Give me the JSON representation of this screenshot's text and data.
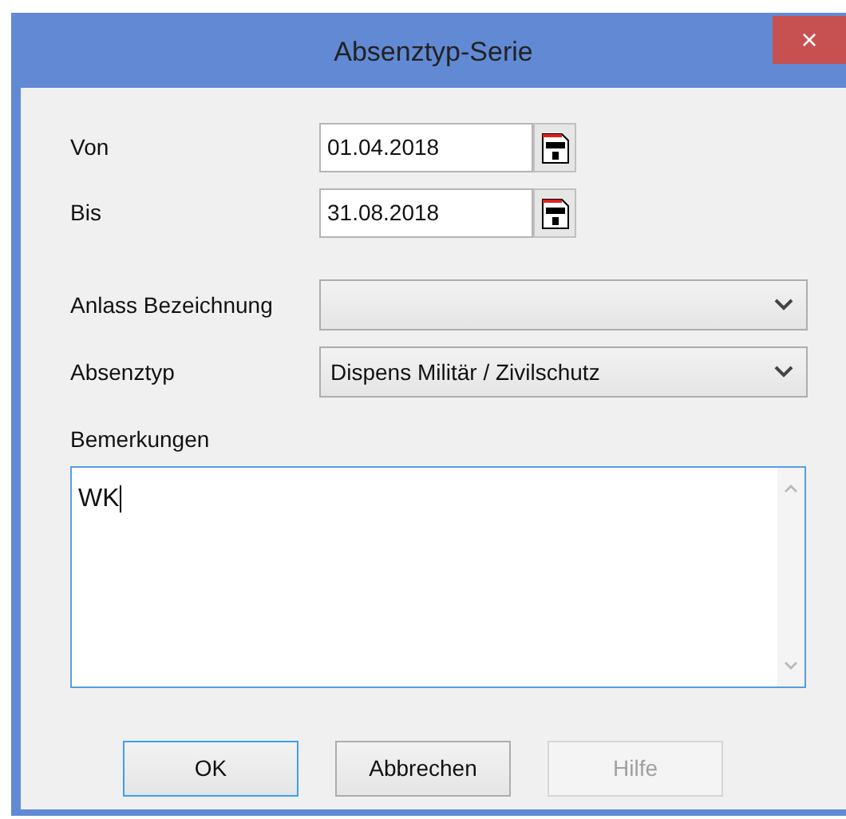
{
  "window": {
    "title": "Absenztyp-Serie",
    "close": "×"
  },
  "fields": [
    {
      "kind": "date",
      "label": "Von",
      "value": "01.04.2018"
    },
    {
      "kind": "date",
      "label": "Bis",
      "value": "31.08.2018"
    },
    {
      "kind": "combo",
      "label": "Anlass Bezeichnung"
    },
    {
      "kind": "combo",
      "label": "Absenztyp",
      "value": "Dispens Militär / Zivilschutz"
    }
  ],
  "remarks": {
    "label": "Bemerkungen",
    "value": "WK"
  },
  "buttons": [
    {
      "label": "OK",
      "focused": true,
      "disabled": false
    },
    {
      "label": "Abbrechen",
      "focused": false,
      "disabled": false
    },
    {
      "label": "Hilfe",
      "focused": false,
      "disabled": true
    }
  ]
}
